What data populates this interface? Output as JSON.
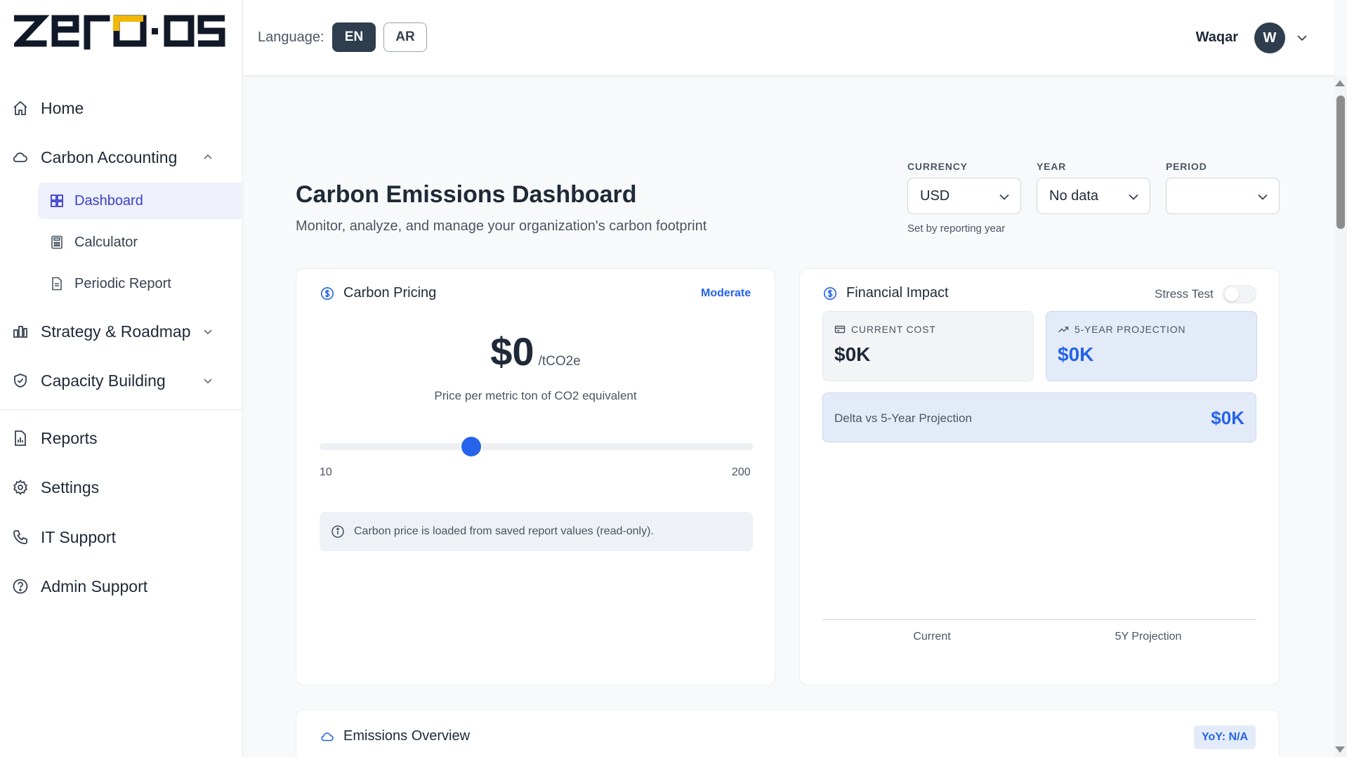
{
  "app": {
    "logo_text": "zero·os"
  },
  "sidebar": {
    "items": [
      {
        "label": "Home",
        "icon": "home-icon"
      },
      {
        "label": "Carbon Accounting",
        "icon": "cloud-icon",
        "expanded": true,
        "children": [
          {
            "label": "Dashboard",
            "icon": "dashboard-grid-icon",
            "active": true
          },
          {
            "label": "Calculator",
            "icon": "calculator-icon"
          },
          {
            "label": "Periodic Report",
            "icon": "document-icon"
          }
        ]
      },
      {
        "label": "Strategy & Roadmap",
        "icon": "columns-icon",
        "expanded": false
      },
      {
        "label": "Capacity Building",
        "icon": "shield-icon",
        "expanded": false
      },
      {
        "label": "Reports",
        "icon": "report-icon"
      },
      {
        "label": "Settings",
        "icon": "gear-icon"
      },
      {
        "label": "IT Support",
        "icon": "phone-icon"
      },
      {
        "label": "Admin Support",
        "icon": "help-circle-icon"
      }
    ]
  },
  "topbar": {
    "language_label": "Language:",
    "languages": [
      "EN",
      "AR"
    ],
    "selected_language": "EN",
    "user_name": "Waqar",
    "avatar_initial": "W"
  },
  "header": {
    "title": "Carbon Emissions Dashboard",
    "subtitle": "Monitor, analyze, and manage your organization's carbon footprint"
  },
  "filters": {
    "currency": {
      "label": "CURRENCY",
      "value": "USD",
      "hint": "Set by reporting year"
    },
    "year": {
      "label": "YEAR",
      "value": "No data"
    },
    "period": {
      "label": "PERIOD",
      "value": ""
    }
  },
  "carbon_pricing": {
    "title": "Carbon Pricing",
    "level": "Moderate",
    "price": "$0",
    "unit": "/tCO2e",
    "caption": "Price per metric ton of CO2 equivalent",
    "slider_min": "10",
    "slider_max": "200",
    "slider_position_fraction": 0.35,
    "info": "Carbon price is loaded from saved report values (read-only)."
  },
  "financial_impact": {
    "title": "Financial Impact",
    "stress_test_label": "Stress Test",
    "stress_test_on": false,
    "current_cost_label": "CURRENT COST",
    "current_cost_value": "$0K",
    "projection_label": "5-YEAR PROJECTION",
    "projection_value": "$0K",
    "delta_label": "Delta vs 5-Year Projection",
    "delta_value": "$0K",
    "chart_categories": [
      "Current",
      "5Y Projection"
    ]
  },
  "emissions_overview": {
    "title": "Emissions Overview",
    "yoy_badge": "YoY: N/A"
  },
  "colors": {
    "accent": "#2563eb",
    "nav_active_bg": "#eef0fb",
    "nav_active_text": "#3b3fc9",
    "dark_button": "#2f3e4e",
    "logo_accent": "#f2b705"
  }
}
